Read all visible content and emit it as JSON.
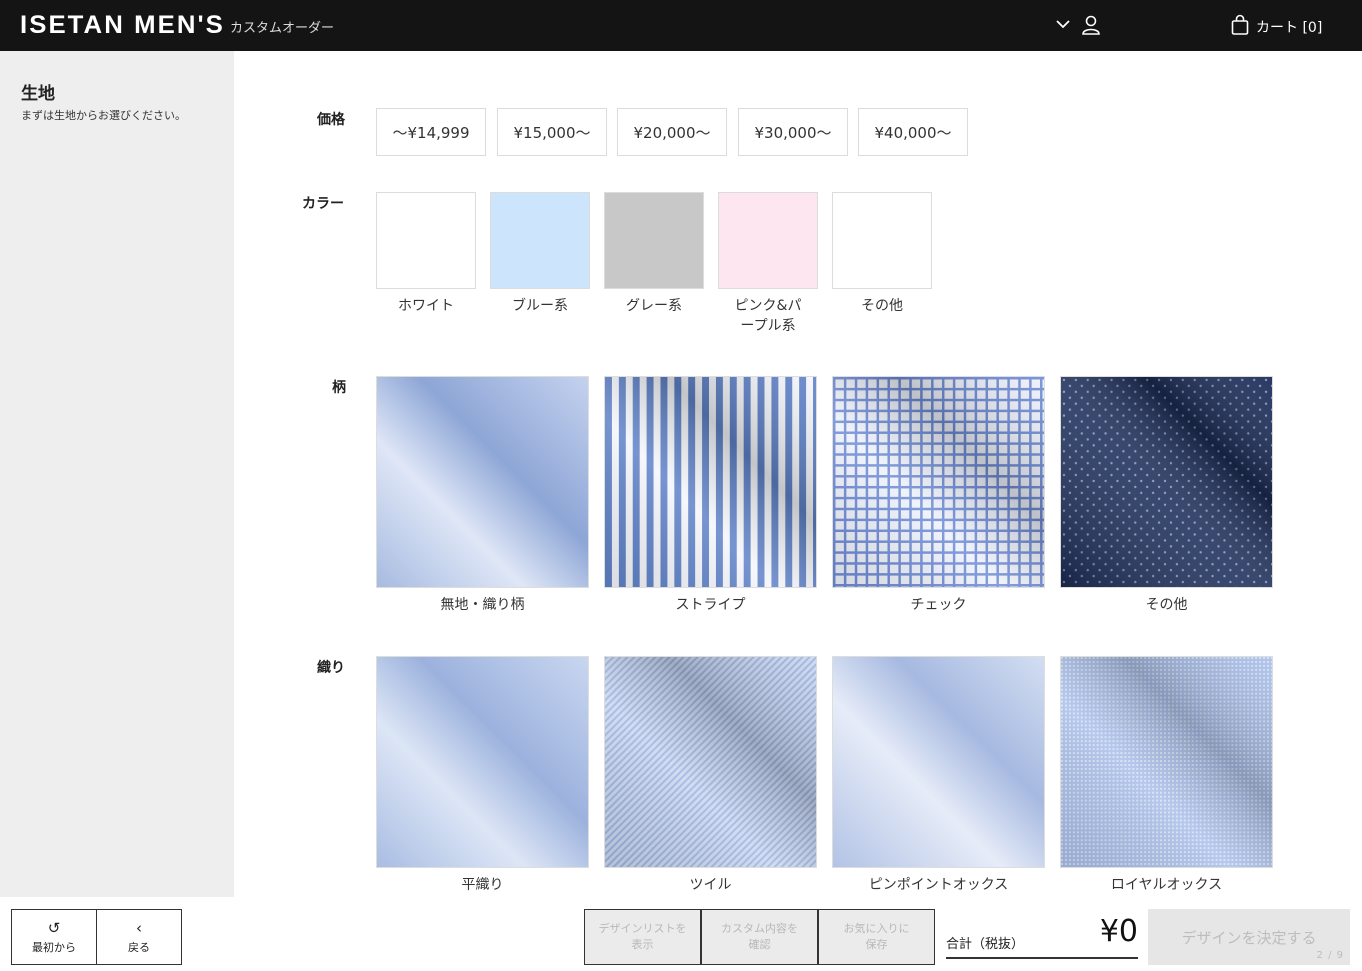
{
  "header": {
    "brand": "ISETAN MEN'S",
    "subtitle": "カスタムオーダー",
    "cart_label": "カート [0]"
  },
  "sidebar": {
    "title": "生地",
    "description": "まずは生地からお選びください。"
  },
  "sections": {
    "price_label": "価格",
    "color_label": "カラー",
    "pattern_label": "柄",
    "weave_label": "織り"
  },
  "prices": [
    "〜¥14,999",
    "¥15,000〜",
    "¥20,000〜",
    "¥30,000〜",
    "¥40,000〜"
  ],
  "colors": [
    {
      "label": "ホワイト",
      "color": "#ffffff"
    },
    {
      "label": "ブルー系",
      "color": "#cce5fc"
    },
    {
      "label": "グレー系",
      "color": "#c8c8c8"
    },
    {
      "label": "ピンク&パ\nープル系",
      "color": "#fde6ef"
    },
    {
      "label": "その他",
      "color": "#ffffff"
    }
  ],
  "patterns": [
    "無地・織り柄",
    "ストライプ",
    "チェック",
    "その他"
  ],
  "weaves": [
    "平織り",
    "ツイル",
    "ピンポイントオックス",
    "ロイヤルオックス"
  ],
  "footer": {
    "restart_label": "最初から",
    "back_label": "戻る",
    "design_list_label": "デザインリストを\n表示",
    "confirm_label": "カスタム内容を\n確認",
    "favorite_label": "お気に入りに\n保存",
    "total_label": "合計（税抜）",
    "total_value": "¥0",
    "decide_label": "デザインを決定する",
    "step": "2 / 9"
  }
}
